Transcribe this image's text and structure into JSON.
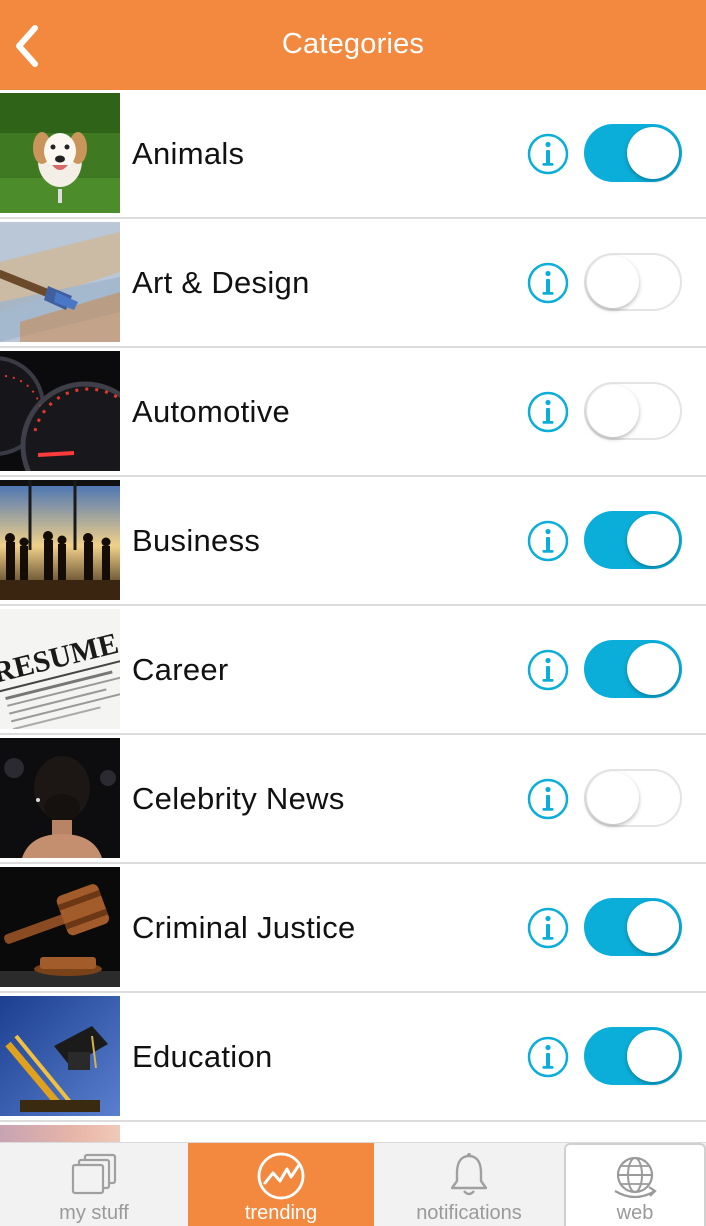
{
  "header": {
    "title": "Categories",
    "back_icon": "chevron-left-icon",
    "color": "#f3883f"
  },
  "categories": [
    {
      "label": "Animals",
      "enabled": true,
      "thumb": "dog-photo"
    },
    {
      "label": "Art & Design",
      "enabled": false,
      "thumb": "paintbrush-photo"
    },
    {
      "label": "Automotive",
      "enabled": false,
      "thumb": "speedometer-photo"
    },
    {
      "label": "Business",
      "enabled": true,
      "thumb": "business-people-photo"
    },
    {
      "label": "Career",
      "enabled": true,
      "thumb": "resume-photo"
    },
    {
      "label": "Celebrity News",
      "enabled": false,
      "thumb": "woman-hair-bun-photo"
    },
    {
      "label": "Criminal Justice",
      "enabled": true,
      "thumb": "gavel-photo"
    },
    {
      "label": "Education",
      "enabled": true,
      "thumb": "graduation-cap-photo"
    }
  ],
  "accent_on": "#0aaed9",
  "tabs": [
    {
      "label": "my stuff",
      "icon": "folders-icon",
      "active": false
    },
    {
      "label": "trending",
      "icon": "trending-icon",
      "active": true
    },
    {
      "label": "notifications",
      "icon": "bell-icon",
      "active": false
    },
    {
      "label": "web",
      "icon": "globe-icon",
      "active": false
    }
  ]
}
